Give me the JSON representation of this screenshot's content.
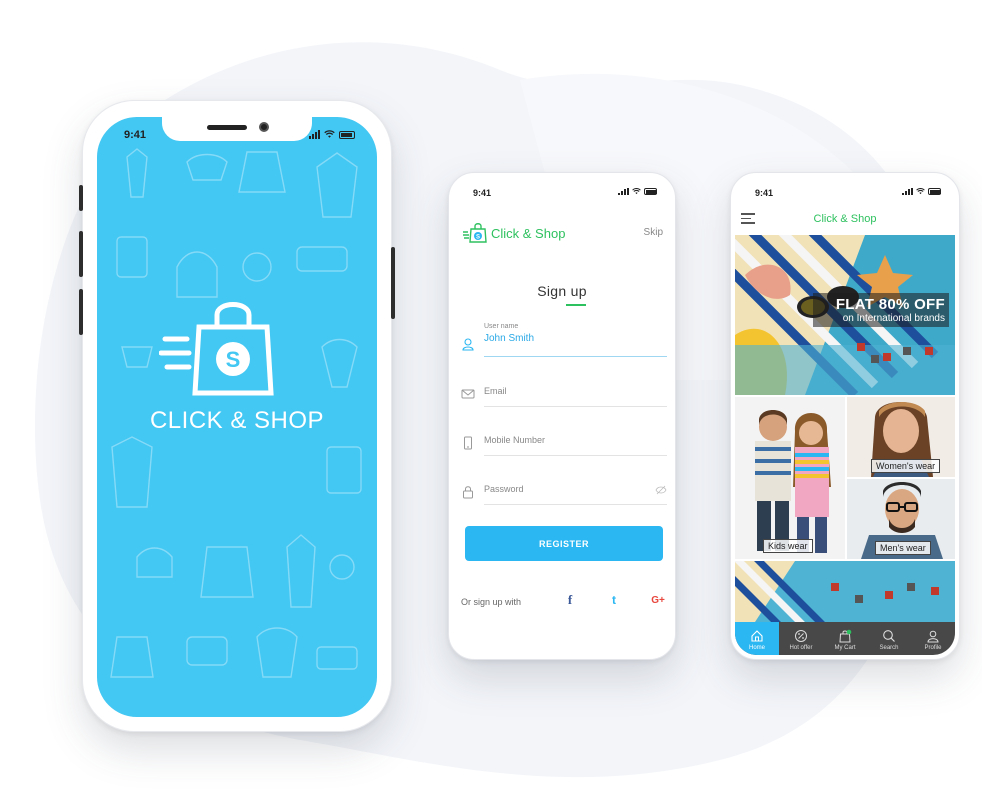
{
  "splash": {
    "time": "9:41",
    "title": "CLICK & SHOP",
    "logo_icon": "shopping-bag-icon",
    "colors": {
      "background": "#43c7f3"
    }
  },
  "signup": {
    "time": "9:41",
    "brand": "Click & Shop",
    "skip": "Skip",
    "title": "Sign up",
    "fields": [
      {
        "icon": "user-icon",
        "label": "User name",
        "value": "John Smith"
      },
      {
        "icon": "mail-icon",
        "placeholder": "Email"
      },
      {
        "icon": "phone-icon",
        "placeholder": "Mobile Number"
      },
      {
        "icon": "lock-icon",
        "placeholder": "Password"
      }
    ],
    "register": "REGISTER",
    "social_label": "Or sign up with",
    "social": [
      "f",
      "t",
      "G+"
    ],
    "colors": {
      "accent": "#2bb7f1",
      "brand": "#2ec15f"
    }
  },
  "home": {
    "time": "9:41",
    "title": "Click & Shop",
    "banner": {
      "line1": "FLAT 80% OFF",
      "line2": "on International brands"
    },
    "tiles": {
      "women": "Women's wear",
      "kids": "Kids wear",
      "men": "Men's wear"
    },
    "tabs": [
      "Home",
      "Hot offer",
      "My Cart",
      "Search",
      "Profile"
    ],
    "colors": {
      "active_tab": "#2bb7f1",
      "tabbar": "#484848"
    }
  }
}
